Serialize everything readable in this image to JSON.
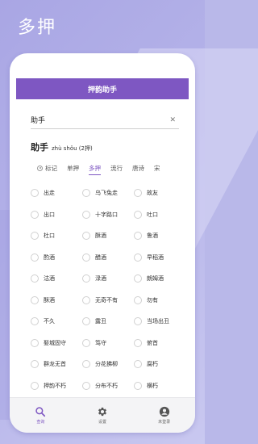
{
  "promo": {
    "title": "多押"
  },
  "app": {
    "header_title": "押韵助手",
    "search": {
      "value": "助手",
      "placeholder": ""
    },
    "word": {
      "text": "助手",
      "pinyin": "zhù shǒu (2押)"
    },
    "tabs": [
      {
        "label": "标记"
      },
      {
        "label": "单押"
      },
      {
        "label": "多押"
      },
      {
        "label": "流行"
      },
      {
        "label": "唐诗"
      },
      {
        "label": "宋"
      }
    ],
    "active_tab": "多押",
    "results": [
      [
        "出走",
        "乌飞兔走",
        "故友"
      ],
      [
        "出口",
        "十字路口",
        "吐口"
      ],
      [
        "杜口",
        "酥酒",
        "鲁酒"
      ],
      [
        "酌酒",
        "醋酒",
        "早稻酒"
      ],
      [
        "沽酒",
        "渌酒",
        "朗姆酒"
      ],
      [
        "酥酒",
        "无奇不有",
        "勿有"
      ],
      [
        "不久",
        "露丑",
        "当场出丑"
      ],
      [
        "娶城固守",
        "笃守",
        "俯首"
      ],
      [
        "群龙无首",
        "分花拂柳",
        "腐朽"
      ],
      [
        "押韵不朽",
        "分布不朽",
        "横朽"
      ]
    ],
    "nav": [
      {
        "label": "查询",
        "icon": "search-icon"
      },
      {
        "label": "设置",
        "icon": "gear-icon"
      },
      {
        "label": "未登录",
        "icon": "user-icon"
      }
    ],
    "colors": {
      "accent": "#7e57c2",
      "background": "#b9b8e9"
    }
  }
}
